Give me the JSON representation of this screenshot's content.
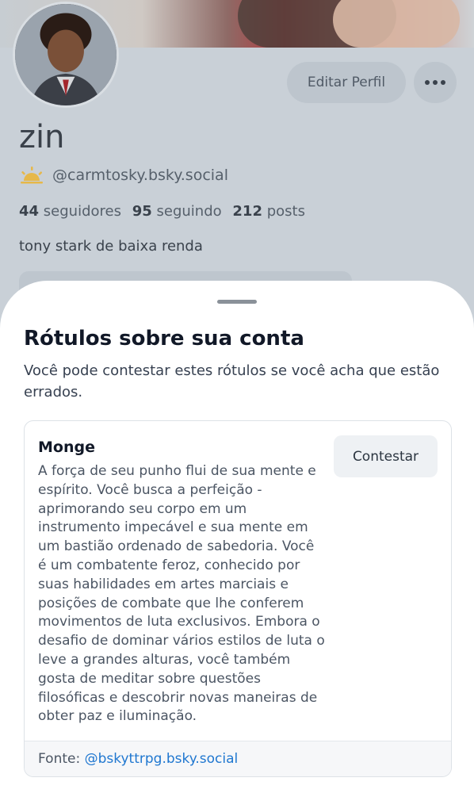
{
  "profile": {
    "display_name": "zin",
    "handle": "@carmtosky.bsky.social",
    "edit_button": "Editar Perfil",
    "stats": {
      "followers_count": "44",
      "followers_label": "seguidores",
      "following_count": "95",
      "following_label": "seguindo",
      "posts_count": "212",
      "posts_label": "posts"
    },
    "bio": "tony stark de baixa renda"
  },
  "sheet": {
    "title": "Rótulos sobre sua conta",
    "subtitle": "Você pode contestar estes rótulos se você acha que estão errados.",
    "label": {
      "name": "Monge",
      "contest_button": "Contestar",
      "description": "A força de seu punho flui de sua mente e espírito. Você busca a perfeição - aprimorando seu corpo em um instrumento impecável e sua mente em um bastião ordenado de sabedoria. Você é um combatente feroz, conhecido por suas habilidades em artes marciais e posições de combate que lhe conferem movimentos de luta exclusivos. Embora o desafio de dominar vários estilos de luta o leve a grandes alturas, você também gosta de meditar sobre questões filosóficas e descobrir novas maneiras de obter paz e iluminação.",
      "source_prefix": "Fonte:",
      "source_link": "@bskyttrpg.bsky.social"
    }
  },
  "colors": {
    "link": "#1f77d0",
    "overlay_bg": "#c9d0d7",
    "sun_icon": "#e6b84a"
  },
  "icons": {
    "more": "more-horizontal-icon",
    "handle_badge": "sunrise-icon"
  }
}
